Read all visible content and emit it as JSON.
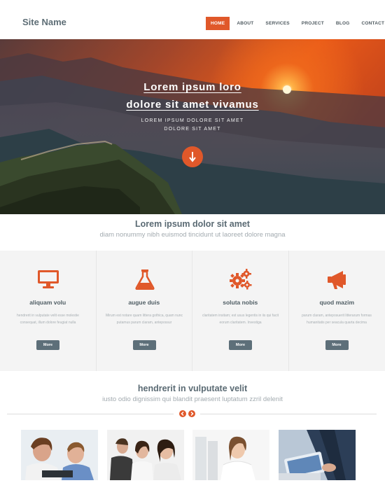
{
  "header": {
    "site_name": "Site Name",
    "nav": [
      {
        "label": "HOME",
        "active": true
      },
      {
        "label": "ABOUT",
        "active": false
      },
      {
        "label": "SERVICES",
        "active": false
      },
      {
        "label": "PROJECT",
        "active": false
      },
      {
        "label": "BLOG",
        "active": false
      },
      {
        "label": "CONTACT",
        "active": false
      }
    ]
  },
  "hero": {
    "title_line1": "Lorem ipsum loro",
    "title_line2": "dolore sit amet vivamus",
    "subtitle_line1": "LOREM IPSUM DOLORE SIT AMET",
    "subtitle_line2": "DOLORE SIT AMET",
    "scroll_icon": "arrow-down-icon"
  },
  "intro": {
    "title": "Lorem ipsum dolor sit amet",
    "subtitle": "diam nonummy nibh euismod tincidunt ut laoreet dolore magna"
  },
  "features": [
    {
      "icon": "monitor-icon",
      "title": "aliquam volu",
      "text": "hendrerit in vulputate velit esse molestie consequat, illum dolore feugiat nulla",
      "button": "More"
    },
    {
      "icon": "flask-icon",
      "title": "augue duis",
      "text": "Mirum est notare quam littera gothica, quam nunc putamus parum claram, antepossur",
      "button": "More"
    },
    {
      "icon": "gears-icon",
      "title": "soluta nobis",
      "text": "claritatem insitam; est usus legentis in iis qui facit eorum claritatem. Investiga",
      "button": "More"
    },
    {
      "icon": "megaphone-icon",
      "title": "quod mazim",
      "text": "parum claram, anteposuerit litterarum formas humanitatis per seacula quarta decima",
      "button": "More"
    }
  ],
  "team": {
    "title": "hendrerit in vulputate velit",
    "subtitle": "iusto odio dignissim qui blandit praesent luptatum zzril delenit",
    "prev_icon": "arrow-left-icon",
    "next_icon": "arrow-right-icon"
  },
  "colors": {
    "accent": "#e0582a",
    "button_gray": "#5d6f79",
    "panel_bg": "#f4f4f4"
  }
}
